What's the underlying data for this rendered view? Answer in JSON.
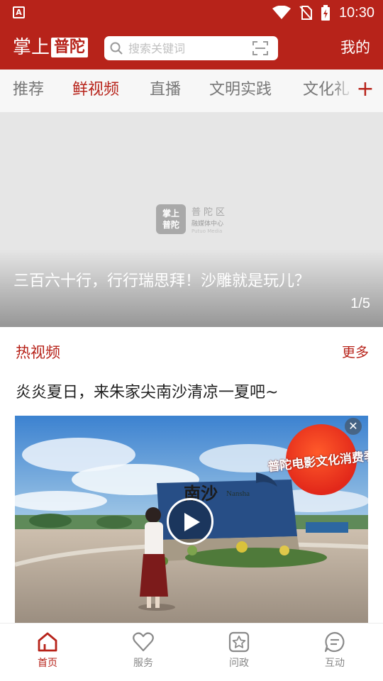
{
  "status_bar": {
    "time": "10:30",
    "app_badge": "A"
  },
  "header": {
    "logo_prefix": "掌上",
    "logo_highlight": "普陀",
    "search_placeholder": "搜索关键词",
    "mine_label": "我的",
    "brand_color": "#b7231a"
  },
  "tabs": [
    {
      "label": "推荐",
      "active": false
    },
    {
      "label": "鲜视频",
      "active": true
    },
    {
      "label": "直播",
      "active": false
    },
    {
      "label": "文明实践",
      "active": false
    },
    {
      "label": "文化礼",
      "active": false
    }
  ],
  "banner": {
    "logo_box_line1": "掌上",
    "logo_box_line2": "普陀",
    "logo_title": "普陀区",
    "logo_subtitle": "融媒体中心",
    "logo_en": "Putuo Media",
    "caption": "三百六十行，行行瑞思拜！沙雕就是玩儿？",
    "pager": "1/5"
  },
  "hot_video": {
    "section_title": "热视频",
    "more_label": "更多",
    "video_title": "炎炎夏日，来朱家尖南沙清凉一夏吧~",
    "badge_text": "普陀电影文化消费季",
    "sign_text": "南沙",
    "sign_en": "Nansha"
  },
  "bottom_nav": [
    {
      "label": "首页",
      "icon": "home-icon",
      "active": true
    },
    {
      "label": "服务",
      "icon": "heart-icon",
      "active": false
    },
    {
      "label": "问政",
      "icon": "star-box-icon",
      "active": false
    },
    {
      "label": "互动",
      "icon": "chat-icon",
      "active": false
    }
  ]
}
